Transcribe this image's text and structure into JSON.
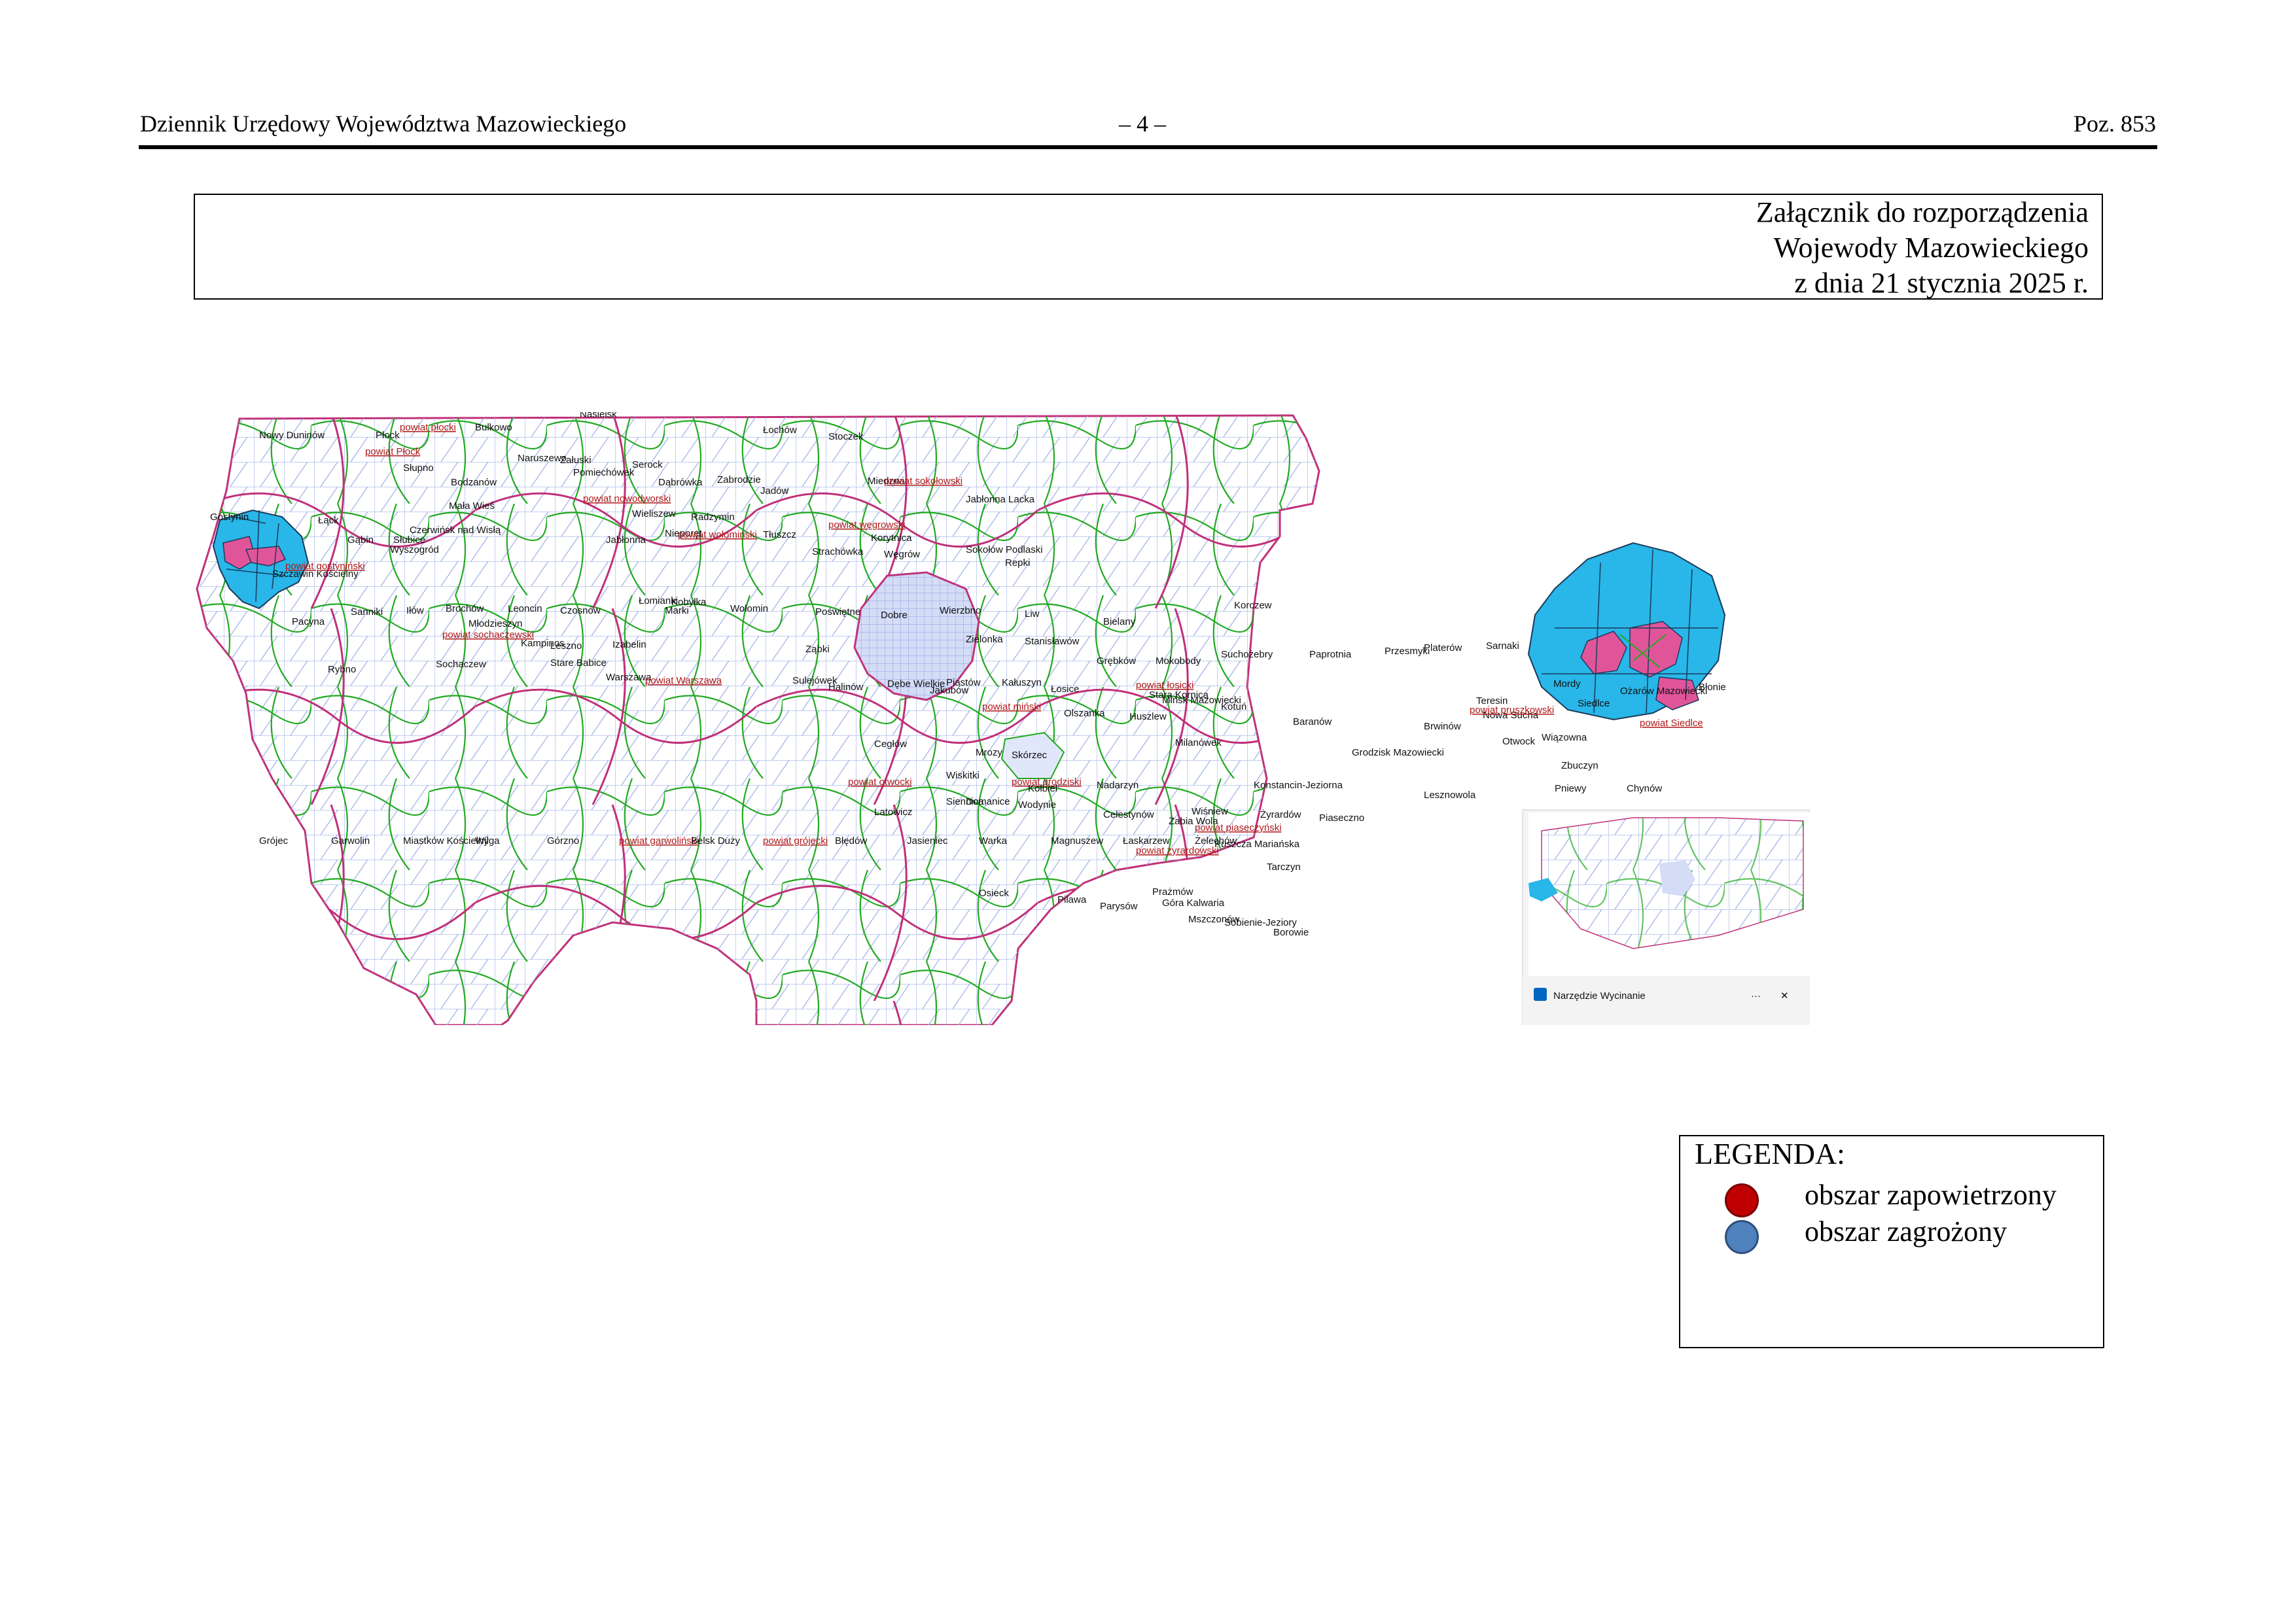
{
  "header": {
    "left": "Dziennik Urzędowy Województwa Mazowieckiego",
    "center": "– 4 –",
    "right": "Poz. 853"
  },
  "annex": {
    "line1": "Załącznik do rozporządzenia",
    "line2": "Wojewody Mazowieckiego",
    "line3": "z dnia 21 stycznia 2025 r."
  },
  "legend": {
    "title": "LEGENDA:",
    "items": [
      {
        "label": "obszar zapowietrzony",
        "color": "#c00000",
        "border": "#7a0000"
      },
      {
        "label": "obszar zagrożony",
        "color": "#4f81bd",
        "border": "#2e4f7a"
      }
    ]
  },
  "map": {
    "colors": {
      "background": "#ffffff",
      "gmina_lines": "#9fb0e6",
      "district_lines": "#22aa22",
      "county_lines": "#c0307a",
      "infected_fill": "#e0559a",
      "threatened_fill": "#29b6e8",
      "warsaw_fill": "#d4dcf6"
    },
    "snipping_tool_label": "Narzędzie Wycinanie",
    "labels": [
      {
        "text": "Nowy Duninów",
        "type": "gmina"
      },
      {
        "text": "Płock",
        "type": "gmina"
      },
      {
        "text": "powiat płocki",
        "type": "powiat"
      },
      {
        "text": "powiat Płock",
        "type": "powiat"
      },
      {
        "text": "Bulkowo",
        "type": "gmina"
      },
      {
        "text": "Słupno",
        "type": "gmina"
      },
      {
        "text": "Bodzanów",
        "type": "gmina"
      },
      {
        "text": "Mała Wieś",
        "type": "gmina"
      },
      {
        "text": "Naruszewo",
        "type": "gmina"
      },
      {
        "text": "Załuski",
        "type": "gmina"
      },
      {
        "text": "Nasielsk",
        "type": "gmina"
      },
      {
        "text": "Pomiechówek",
        "type": "gmina"
      },
      {
        "text": "Serock",
        "type": "gmina"
      },
      {
        "text": "powiat nowodworski",
        "type": "powiat"
      },
      {
        "text": "Dąbrówka",
        "type": "gmina"
      },
      {
        "text": "Zabrodzie",
        "type": "gmina"
      },
      {
        "text": "Jadów",
        "type": "gmina"
      },
      {
        "text": "Łochów",
        "type": "gmina"
      },
      {
        "text": "Stoczek",
        "type": "gmina"
      },
      {
        "text": "Miedzna",
        "type": "gmina"
      },
      {
        "text": "powiat sokołowski",
        "type": "powiat"
      },
      {
        "text": "Jabłonna Lacka",
        "type": "gmina"
      },
      {
        "text": "Gostynin",
        "type": "gmina"
      },
      {
        "text": "powiat gostyniński",
        "type": "powiat"
      },
      {
        "text": "Szczawin Kościelny",
        "type": "gmina"
      },
      {
        "text": "Łąck",
        "type": "gmina"
      },
      {
        "text": "Gąbin",
        "type": "gmina"
      },
      {
        "text": "Słubice",
        "type": "gmina"
      },
      {
        "text": "Czerwińsk nad Wisłą",
        "type": "gmina"
      },
      {
        "text": "Wyszogród",
        "type": "gmina"
      },
      {
        "text": "Wieliszew",
        "type": "gmina"
      },
      {
        "text": "Nieporęt",
        "type": "gmina"
      },
      {
        "text": "Radzymin",
        "type": "gmina"
      },
      {
        "text": "powiat wołomiński",
        "type": "powiat"
      },
      {
        "text": "Tłuszcz",
        "type": "gmina"
      },
      {
        "text": "Strachówka",
        "type": "gmina"
      },
      {
        "text": "powiat węgrowski",
        "type": "powiat"
      },
      {
        "text": "Korytnica",
        "type": "gmina"
      },
      {
        "text": "Węgrów",
        "type": "gmina"
      },
      {
        "text": "Sokołów Podlaski",
        "type": "gmina"
      },
      {
        "text": "Repki",
        "type": "gmina"
      },
      {
        "text": "Jabłonna",
        "type": "gmina"
      },
      {
        "text": "Pacyna",
        "type": "gmina"
      },
      {
        "text": "Sanniki",
        "type": "gmina"
      },
      {
        "text": "Iłów",
        "type": "gmina"
      },
      {
        "text": "Brochów",
        "type": "gmina"
      },
      {
        "text": "Leoncin",
        "type": "gmina"
      },
      {
        "text": "Czosnów",
        "type": "gmina"
      },
      {
        "text": "Łomianki",
        "type": "gmina"
      },
      {
        "text": "Marki",
        "type": "gmina"
      },
      {
        "text": "Kobyłka",
        "type": "gmina"
      },
      {
        "text": "Wołomin",
        "type": "gmina"
      },
      {
        "text": "Poświętne",
        "type": "gmina"
      },
      {
        "text": "Dobre",
        "type": "gmina"
      },
      {
        "text": "Wierzbno",
        "type": "gmina"
      },
      {
        "text": "Liw",
        "type": "gmina"
      },
      {
        "text": "Bielany",
        "type": "gmina"
      },
      {
        "text": "Korczew",
        "type": "gmina"
      },
      {
        "text": "Młodzieszyn",
        "type": "gmina"
      },
      {
        "text": "powiat sochaczewski",
        "type": "powiat"
      },
      {
        "text": "Kampinos",
        "type": "gmina"
      },
      {
        "text": "Leszno",
        "type": "gmina"
      },
      {
        "text": "Izabelin",
        "type": "gmina"
      },
      {
        "text": "Ząbki",
        "type": "gmina"
      },
      {
        "text": "Zielonka",
        "type": "gmina"
      },
      {
        "text": "Stanisławów",
        "type": "gmina"
      },
      {
        "text": "Grębków",
        "type": "gmina"
      },
      {
        "text": "Mokobody",
        "type": "gmina"
      },
      {
        "text": "Suchożebry",
        "type": "gmina"
      },
      {
        "text": "Paprotnia",
        "type": "gmina"
      },
      {
        "text": "Przesmyki",
        "type": "gmina"
      },
      {
        "text": "Platerów",
        "type": "gmina"
      },
      {
        "text": "Sarnaki",
        "type": "gmina"
      },
      {
        "text": "Rybno",
        "type": "gmina"
      },
      {
        "text": "Sochaczew",
        "type": "gmina"
      },
      {
        "text": "Stare Babice",
        "type": "gmina"
      },
      {
        "text": "Warszawa",
        "type": "gmina"
      },
      {
        "text": "powiat Warszawa",
        "type": "powiat"
      },
      {
        "text": "Sulejówek",
        "type": "gmina"
      },
      {
        "text": "Halinów",
        "type": "gmina"
      },
      {
        "text": "Dębe Wielkie",
        "type": "gmina"
      },
      {
        "text": "Jakubów",
        "type": "gmina"
      },
      {
        "text": "Kałuszyn",
        "type": "gmina"
      },
      {
        "text": "Łosice",
        "type": "gmina"
      },
      {
        "text": "powiat łosicki",
        "type": "powiat"
      },
      {
        "text": "Stara Kornica",
        "type": "gmina"
      },
      {
        "text": "Mordy",
        "type": "gmina"
      },
      {
        "text": "Ożarów Mazowiecki",
        "type": "gmina"
      },
      {
        "text": "Błonie",
        "type": "gmina"
      },
      {
        "text": "Teresin",
        "type": "gmina"
      },
      {
        "text": "Nowa Sucha",
        "type": "gmina"
      },
      {
        "text": "Piastów",
        "type": "gmina"
      },
      {
        "text": "powiat miński",
        "type": "powiat"
      },
      {
        "text": "Mińsk Mazowiecki",
        "type": "gmina"
      },
      {
        "text": "Kotuń",
        "type": "gmina"
      },
      {
        "text": "Siedlce",
        "type": "gmina"
      },
      {
        "text": "powiat Siedlce",
        "type": "powiat"
      },
      {
        "text": "Olszanka",
        "type": "gmina"
      },
      {
        "text": "Huszlew",
        "type": "gmina"
      },
      {
        "text": "Baranów",
        "type": "gmina"
      },
      {
        "text": "Brwinów",
        "type": "gmina"
      },
      {
        "text": "powiat pruszkowski",
        "type": "powiat"
      },
      {
        "text": "Wiązowna",
        "type": "gmina"
      },
      {
        "text": "Cegłów",
        "type": "gmina"
      },
      {
        "text": "Mrozy",
        "type": "gmina"
      },
      {
        "text": "Skórzec",
        "type": "gmina"
      },
      {
        "text": "Milanówek",
        "type": "gmina"
      },
      {
        "text": "Grodzisk Mazowiecki",
        "type": "gmina"
      },
      {
        "text": "Otwock",
        "type": "gmina"
      },
      {
        "text": "Zbuczyn",
        "type": "gmina"
      },
      {
        "text": "Wiskitki",
        "type": "gmina"
      },
      {
        "text": "powiat grodziski",
        "type": "powiat"
      },
      {
        "text": "Nadarzyn",
        "type": "gmina"
      },
      {
        "text": "Konstancin-Jeziorna",
        "type": "gmina"
      },
      {
        "text": "Lesznowola",
        "type": "gmina"
      },
      {
        "text": "powiat otwocki",
        "type": "powiat"
      },
      {
        "text": "Kołbiel",
        "type": "gmina"
      },
      {
        "text": "Siennica",
        "type": "gmina"
      },
      {
        "text": "Domanice",
        "type": "gmina"
      },
      {
        "text": "Wiśniew",
        "type": "gmina"
      },
      {
        "text": "Żyrardów",
        "type": "gmina"
      },
      {
        "text": "Piaseczno",
        "type": "gmina"
      },
      {
        "text": "Celestynów",
        "type": "gmina"
      },
      {
        "text": "Latowicz",
        "type": "gmina"
      },
      {
        "text": "Wodynie",
        "type": "gmina"
      },
      {
        "text": "Żabia Wola",
        "type": "gmina"
      },
      {
        "text": "powiat piaseczyński",
        "type": "powiat"
      },
      {
        "text": "powiat żyrardowski",
        "type": "powiat"
      },
      {
        "text": "Puszcza Mariańska",
        "type": "gmina"
      },
      {
        "text": "Tarczyn",
        "type": "gmina"
      },
      {
        "text": "Prażmów",
        "type": "gmina"
      },
      {
        "text": "Góra Kalwaria",
        "type": "gmina"
      },
      {
        "text": "Osieck",
        "type": "gmina"
      },
      {
        "text": "Pilawa",
        "type": "gmina"
      },
      {
        "text": "Parysów",
        "type": "gmina"
      },
      {
        "text": "Mszczonów",
        "type": "gmina"
      },
      {
        "text": "Sobienie-Jeziory",
        "type": "gmina"
      },
      {
        "text": "Borowie",
        "type": "gmina"
      },
      {
        "text": "Pniewy",
        "type": "gmina"
      },
      {
        "text": "Chynów",
        "type": "gmina"
      },
      {
        "text": "Grójec",
        "type": "gmina"
      },
      {
        "text": "Garwolin",
        "type": "gmina"
      },
      {
        "text": "Miastków Kościelny",
        "type": "gmina"
      },
      {
        "text": "Wilga",
        "type": "gmina"
      },
      {
        "text": "Górzno",
        "type": "gmina"
      },
      {
        "text": "powiat garwoliński",
        "type": "powiat"
      },
      {
        "text": "Belsk Duży",
        "type": "gmina"
      },
      {
        "text": "powiat grójecki",
        "type": "powiat"
      },
      {
        "text": "Błędów",
        "type": "gmina"
      },
      {
        "text": "Jasieniec",
        "type": "gmina"
      },
      {
        "text": "Warka",
        "type": "gmina"
      },
      {
        "text": "Magnuszew",
        "type": "gmina"
      },
      {
        "text": "Łaskarzew",
        "type": "gmina"
      },
      {
        "text": "Żelechów",
        "type": "gmina"
      }
    ]
  }
}
